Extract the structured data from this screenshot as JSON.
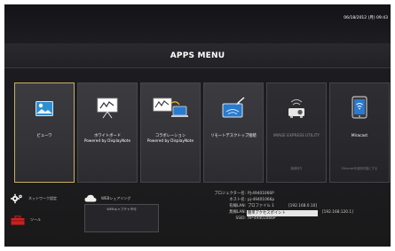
{
  "status": {
    "datetime": "06/18/2012 (月) 09:43"
  },
  "header": {
    "title": "APPS MENU"
  },
  "tiles": [
    {
      "label": "ビューワ",
      "icon": "image-viewer-icon"
    },
    {
      "label": "ホワイトボード\nPowered by DisplayNote",
      "icon": "whiteboard-icon"
    },
    {
      "label": "コラボレーション\nPowered by DisplayNote",
      "icon": "collaboration-icon"
    },
    {
      "label": "リモートデスクトップ接続",
      "icon": "remote-desktop-icon"
    },
    {
      "label": "IMAGE EXPRESS UTILITY",
      "footnote": "接続待ち",
      "icon": "projector-wireless-icon"
    },
    {
      "label": "Miracast",
      "footnote": "Miracastを使用可能にする",
      "icon": "tablet-icon"
    }
  ],
  "bottom": {
    "network_label": "ネットワーク設定",
    "tools_label": "ツール",
    "web_share_label": "WEBシェアリング",
    "web_capture_label": "WEBキャプチャ不可"
  },
  "info": {
    "projector_name_key": "プロジェクター名:",
    "projector_name": "PJ-49401066P",
    "host_key": "ホスト名:",
    "host": "pj-49401066p",
    "wired_lan_key": "有線LAN:",
    "wired_lan": "プロファイル 1",
    "wired_ip": "[192.168.0.10]",
    "wireless_lan_key": "無線LAN:",
    "wireless_lan": "簡単アクセスポイント",
    "wireless_ip": "[192.168.120.1]",
    "ssid_key": "SSID:",
    "ssid": "AP-49401066P"
  },
  "colors": {
    "selected_border": "#c8b060",
    "background": "#1e1e22",
    "tile": "#38383d"
  }
}
